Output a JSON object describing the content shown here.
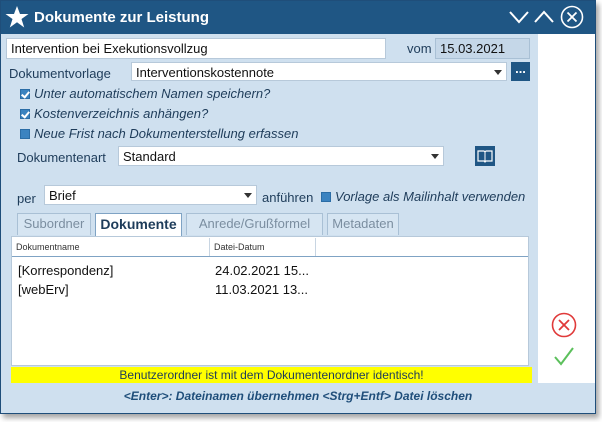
{
  "window": {
    "title": "Dokumente zur Leistung"
  },
  "titlebar_icons": [
    "star-icon",
    "chevron-down-icon",
    "chevron-up-icon",
    "close-circle-icon"
  ],
  "form": {
    "subject_value": "Intervention bei Exekutionsvollzug",
    "date_label": "vom",
    "date_value": "15.03.2021",
    "template_label": "Dokumentvorlage",
    "template_value": "Interventionskostennote",
    "browse_label": "...",
    "checkboxes": [
      {
        "label": "Unter automatischem Namen speichern?",
        "checked": true
      },
      {
        "label": "Kostenverzeichnis anhängen?",
        "checked": true
      },
      {
        "label": "Neue Frist nach Dokumenterstellung erfassen",
        "checked": false
      }
    ],
    "doctype_label": "Dokumentenart",
    "doctype_value": "Standard",
    "per_label": "per",
    "per_value": "Brief",
    "per_suffix": "anführen",
    "mail_checkbox": {
      "label": "Vorlage als Mailinhalt verwenden",
      "checked": false
    }
  },
  "tabs": [
    {
      "label": "Subordner",
      "active": false
    },
    {
      "label": "Dokumente",
      "active": true
    },
    {
      "label": "Anrede/Grußformel",
      "active": false
    },
    {
      "label": "Metadaten",
      "active": false
    }
  ],
  "table": {
    "columns": [
      "Dokumentname",
      "Datei-Datum"
    ],
    "rows": [
      [
        "[Korrespondenz]",
        "24.02.2021 15..."
      ],
      [
        "[webErv]",
        "11.03.2021 13..."
      ]
    ]
  },
  "warning": "Benutzerordner ist mit dem Dokumentenordner identisch!",
  "hint": "<Enter>: Dateinamen übernehmen <Strg+Entf> Datei löschen",
  "colors": {
    "titlebar": "#1f5684",
    "body": "#cfe0ef",
    "warning": "#ffff00",
    "cancel": "#e03a3a",
    "ok": "#5cc05c"
  }
}
